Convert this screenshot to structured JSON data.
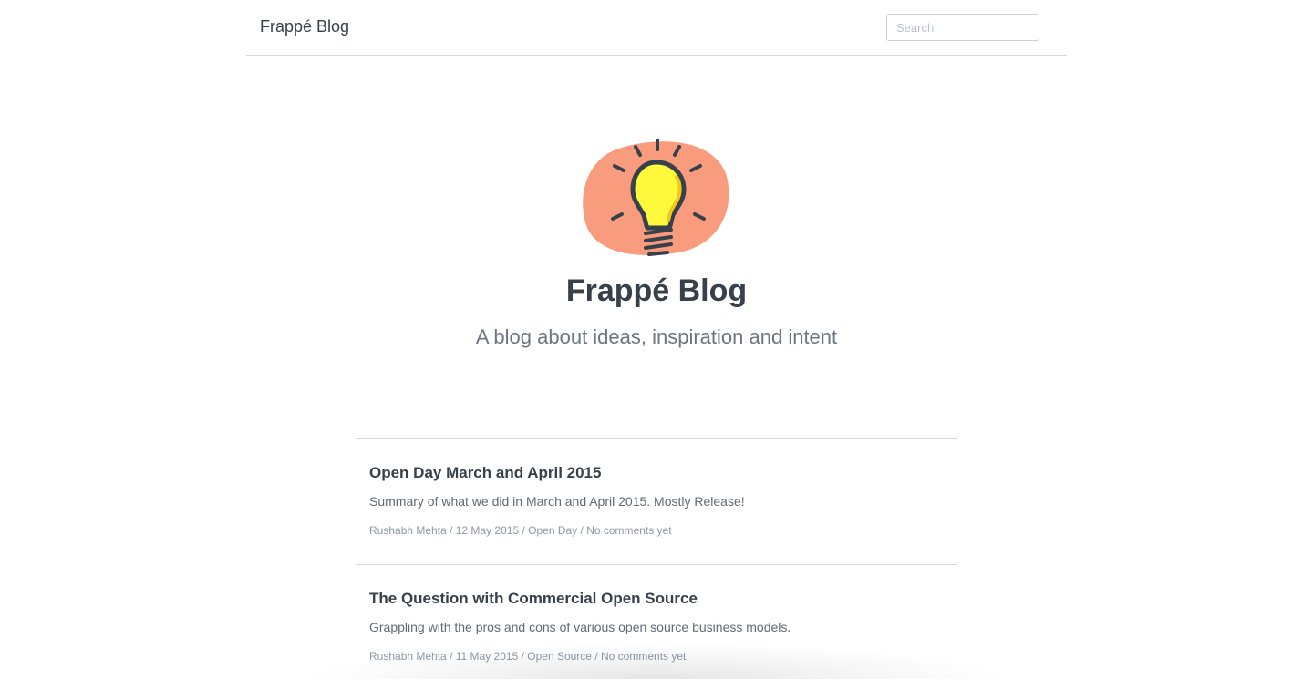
{
  "navbar": {
    "brand": "Frappé Blog",
    "search_placeholder": "Search"
  },
  "hero": {
    "logo_icon": "lightbulb-icon",
    "title": "Frappé Blog",
    "subtitle": "A blog about ideas, inspiration and intent"
  },
  "colors": {
    "logo_blob": "#f99b7d",
    "bulb_fill": "#fff93c",
    "bulb_shade": "#f5c518",
    "ink": "#36414c"
  },
  "posts": [
    {
      "title": "Open Day March and April 2015",
      "summary": "Summary of what we did in March and April 2015. Mostly Release!",
      "author": "Rushabh Mehta",
      "date": "12 May 2015",
      "category": "Open Day",
      "comments": "No comments yet"
    },
    {
      "title": "The Question with Commercial Open Source",
      "summary": "Grappling with the pros and cons of various open source business models.",
      "author": "Rushabh Mehta",
      "date": "11 May 2015",
      "category": "Open Source",
      "comments": "No comments yet"
    }
  ]
}
